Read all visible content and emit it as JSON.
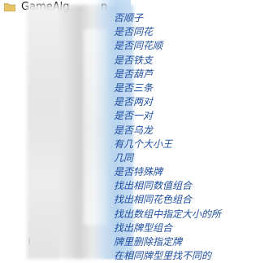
{
  "header": {
    "title": "GameAlg",
    "title_fragment": "n"
  },
  "items": [
    "否顺子",
    "是否同花",
    "是否同花顺",
    "是否铁支",
    "是否葫芦",
    "是否三条",
    "是否两对",
    "是否一对",
    "是否乌龙",
    "有几个大小王",
    "几同",
    "是否特殊牌",
    "找出相同数值组合",
    "找出相同花色组合",
    "找出数组中指定大小的所",
    "找出牌型组合",
    "牌里删除指定牌",
    "在相同牌型里找不同的"
  ],
  "tree_marker": "⌊"
}
